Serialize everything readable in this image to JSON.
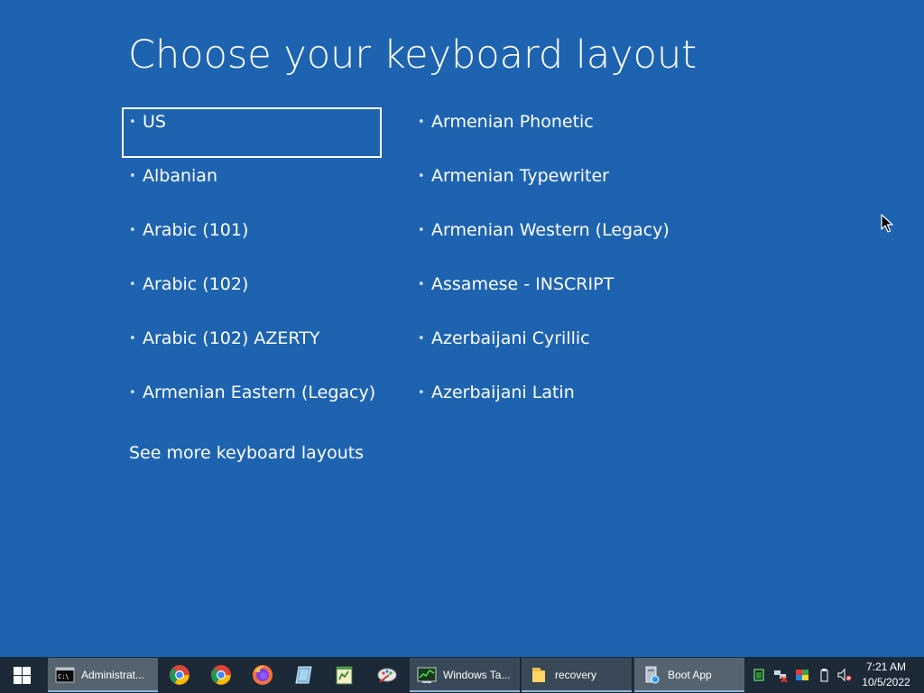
{
  "heading": "Choose your keyboard layout",
  "layouts": {
    "column1": [
      "US",
      "Albanian",
      "Arabic (101)",
      "Arabic (102)",
      "Arabic (102) AZERTY",
      "Armenian Eastern (Legacy)"
    ],
    "column2": [
      "Armenian Phonetic",
      "Armenian Typewriter",
      "Armenian Western (Legacy)",
      "Assamese - INSCRIPT",
      "Azerbaijani Cyrillic",
      "Azerbaijani Latin"
    ],
    "selected": "US",
    "bullet": "•"
  },
  "more_link": "See more keyboard layouts",
  "taskbar": {
    "buttons": [
      {
        "label": "Administrat...",
        "icon": "cmd-icon"
      },
      {
        "label": "Windows Ta...",
        "icon": "task-manager-icon"
      },
      {
        "label": "recovery",
        "icon": "folder-icon"
      },
      {
        "label": "Boot App",
        "icon": "boot-app-icon"
      }
    ],
    "pinned": [
      "chrome-icon",
      "chrome-icon",
      "firefox-icon",
      "app-icon",
      "notepad-icon",
      "paint-icon"
    ],
    "clock_time": "7:21 AM",
    "clock_date": "10/5/2022"
  },
  "colors": {
    "background": "#1e63b0",
    "taskbar": "#1c2a38",
    "text": "#ffffff"
  }
}
